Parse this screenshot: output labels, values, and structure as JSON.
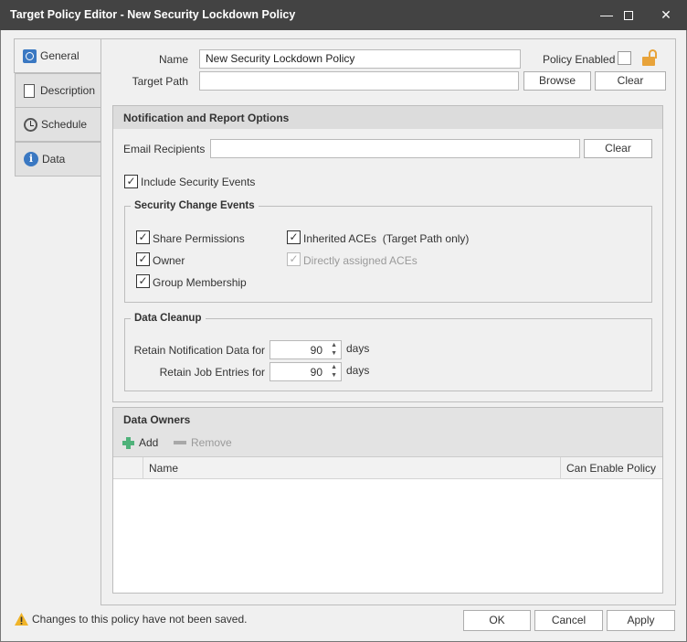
{
  "window": {
    "title": "Target Policy Editor - New Security Lockdown Policy"
  },
  "tabs": [
    {
      "label": "General",
      "icon": "safe-icon"
    },
    {
      "label": "Description",
      "icon": "document-icon"
    },
    {
      "label": "Schedule",
      "icon": "clock-icon"
    },
    {
      "label": "Data",
      "icon": "info-icon"
    }
  ],
  "general": {
    "name_label": "Name",
    "name_value": "New Security Lockdown Policy",
    "policy_enabled_label": "Policy Enabled",
    "policy_enabled": false,
    "target_path_label": "Target Path",
    "target_path_value": "",
    "browse": "Browse",
    "clear": "Clear"
  },
  "notification": {
    "header": "Notification and Report Options",
    "email_label": "Email Recipients",
    "email_value": "",
    "clear": "Clear",
    "include_security_events": "Include Security Events",
    "security_group": "Security Change Events",
    "events": {
      "share": "Share Permissions",
      "owner": "Owner",
      "group": "Group Membership",
      "inherited": "Inherited ACEs  (Target Path only)",
      "direct": "Directly assigned ACEs"
    },
    "cleanup_group": "Data Cleanup",
    "retain_notification_label": "Retain Notification Data for",
    "retain_notification_value": "90",
    "retain_job_label": "Retain Job Entries for",
    "retain_job_value": "90",
    "days": "days"
  },
  "owners": {
    "header": "Data Owners",
    "add": "Add",
    "remove": "Remove",
    "columns": [
      "Name",
      "Can Enable Policy"
    ],
    "rows": []
  },
  "footer": {
    "warning": "Changes to this policy have not been saved.",
    "ok": "OK",
    "cancel": "Cancel",
    "apply": "Apply"
  }
}
